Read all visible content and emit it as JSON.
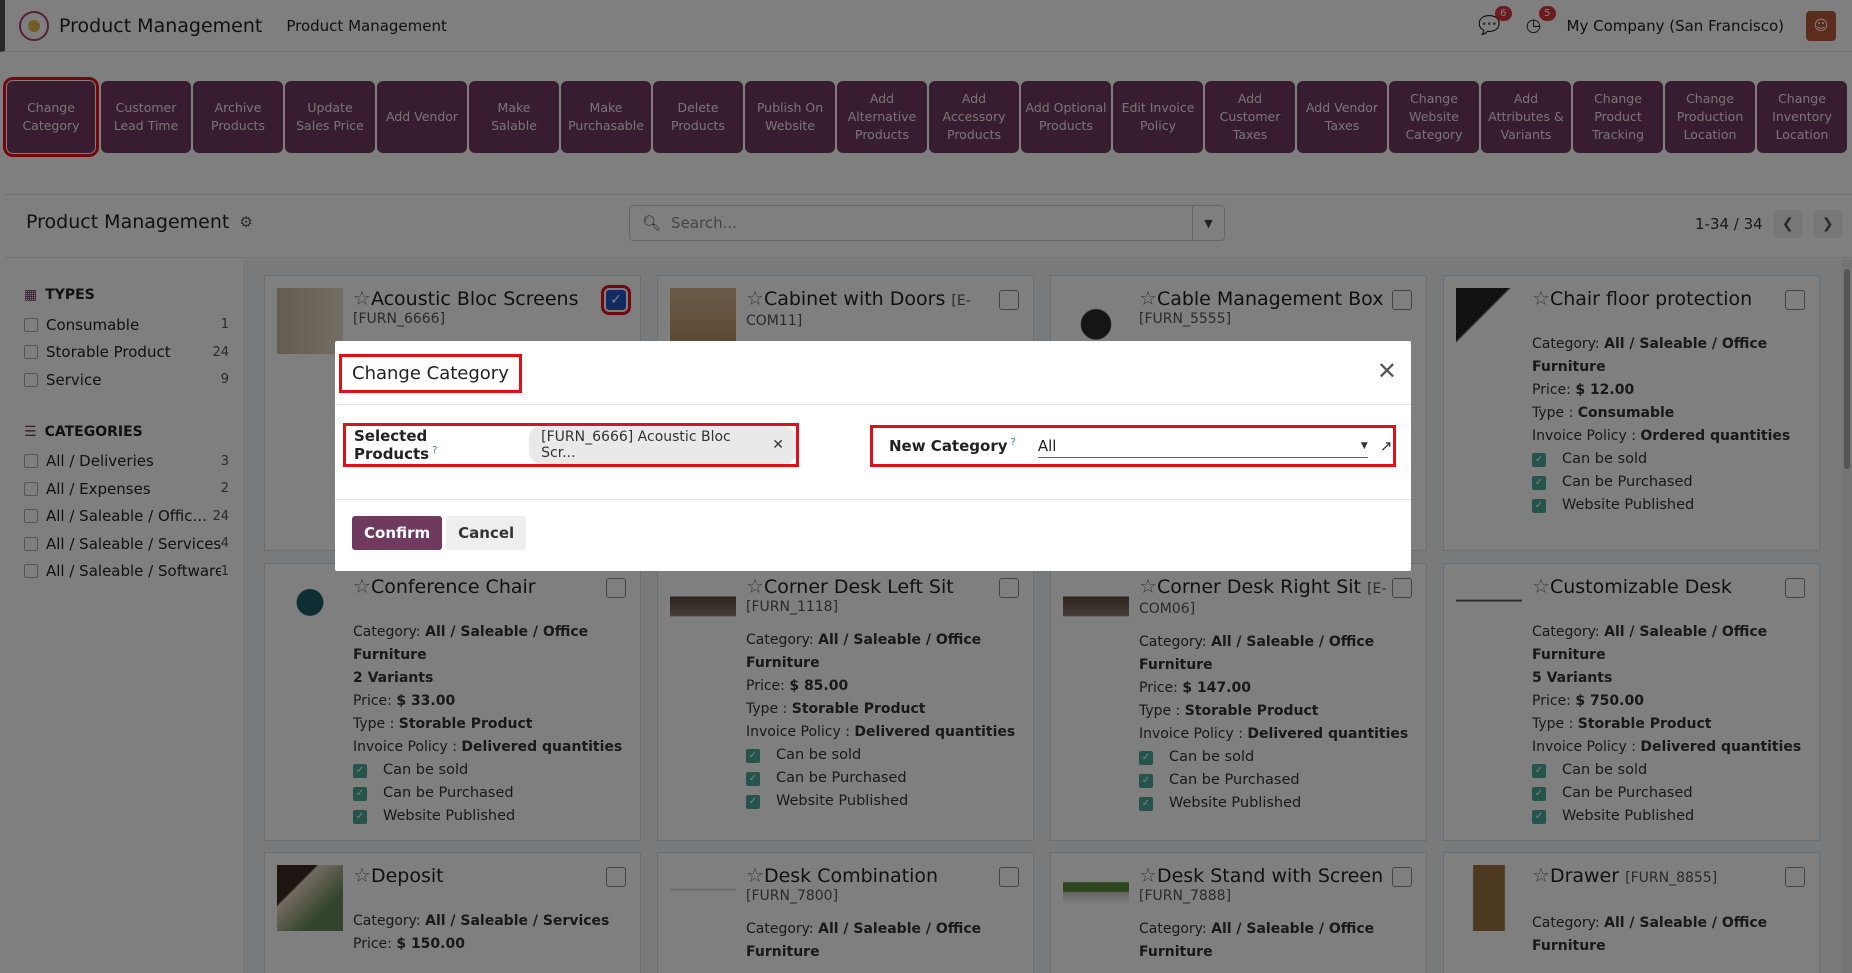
{
  "topbar": {
    "app_name": "Product Management",
    "menu": "Product Management",
    "company": "My Company (San Francisco)",
    "messages_count": "6",
    "activities_count": "5"
  },
  "actions": [
    "Change Category",
    "Customer Lead Time",
    "Archive Products",
    "Update Sales Price",
    "Add Vendor",
    "Make Salable",
    "Make Purchasable",
    "Delete Products",
    "Publish On Website",
    "Add Alternative Products",
    "Add Accessory Products",
    "Add Optional Products",
    "Edit Invoice Policy",
    "Add Customer Taxes",
    "Add Vendor Taxes",
    "Change Website Category",
    "Add Attributes & Variants",
    "Change Product Tracking",
    "Change Production Location",
    "Change Inventory Location"
  ],
  "control_panel": {
    "title": "Product Management",
    "search_placeholder": "Search...",
    "pager": "1-34 / 34"
  },
  "sidebar": {
    "types_title": "TYPES",
    "types": [
      {
        "label": "Consumable",
        "count": "1"
      },
      {
        "label": "Storable Product",
        "count": "24"
      },
      {
        "label": "Service",
        "count": "9"
      }
    ],
    "categories_title": "CATEGORIES",
    "categories": [
      {
        "label": "All / Deliveries",
        "count": "3"
      },
      {
        "label": "All / Expenses",
        "count": "2"
      },
      {
        "label": "All / Saleable / Offic...",
        "count": "24"
      },
      {
        "label": "All / Saleable / Services",
        "count": "4"
      },
      {
        "label": "All / Saleable / Software",
        "count": "1"
      }
    ]
  },
  "cards": {
    "c1": {
      "name": "Acoustic Bloc Screens",
      "ref": "[FURN_6666]"
    },
    "c2": {
      "name": "Cabinet with Doors",
      "ref_inline": "[E-",
      "ref": "COM11]"
    },
    "c3": {
      "name": "Cable Management Box",
      "ref": "[FURN_5555]"
    },
    "c4": {
      "name": "Chair floor protection",
      "cat_label": "Category:",
      "cat1": "All / Saleable / Office",
      "cat2": "Furniture",
      "price_label": "Price:",
      "price": "$ 12.00",
      "type_label": "Type :",
      "type": "Consumable",
      "inv_label": "Invoice Policy :",
      "inv": "Ordered quantities"
    },
    "c5": {
      "name": "Conference Chair",
      "cat_label": "Category:",
      "cat1": "All / Saleable / Office",
      "cat2": "Furniture",
      "variants": "2 Variants",
      "price_label": "Price:",
      "price": "$ 33.00",
      "type_label": "Type :",
      "type": "Storable Product",
      "inv_label": "Invoice Policy :",
      "inv": "Delivered quantities"
    },
    "c6": {
      "name": "Corner Desk Left Sit",
      "ref": "[FURN_1118]",
      "cat_label": "Category:",
      "cat1": "All / Saleable / Office",
      "cat2": "Furniture",
      "price_label": "Price:",
      "price": "$ 85.00",
      "type_label": "Type :",
      "type": "Storable Product",
      "inv_label": "Invoice Policy :",
      "inv": "Delivered quantities"
    },
    "c7": {
      "name": "Corner Desk Right Sit",
      "ref_inline": "[E-",
      "ref": "COM06]",
      "cat_label": "Category:",
      "cat1": "All / Saleable / Office",
      "cat2": "Furniture",
      "price_label": "Price:",
      "price": "$ 147.00",
      "type_label": "Type :",
      "type": "Storable Product",
      "inv_label": "Invoice Policy :",
      "inv": "Delivered quantities"
    },
    "c8": {
      "name": "Customizable Desk",
      "cat_label": "Category:",
      "cat1": "All / Saleable / Office",
      "cat2": "Furniture",
      "variants": "5 Variants",
      "price_label": "Price:",
      "price": "$ 750.00",
      "type_label": "Type :",
      "type": "Storable Product",
      "inv_label": "Invoice Policy :",
      "inv": "Delivered quantities"
    },
    "c9": {
      "name": "Deposit",
      "cat_label": "Category:",
      "cat1": "All / Saleable / Services",
      "price_label": "Price:",
      "price": "$ 150.00"
    },
    "c10": {
      "name": "Desk Combination",
      "ref": "[FURN_7800]",
      "cat_label": "Category:",
      "cat1": "All / Saleable / Office",
      "cat2": "Furniture"
    },
    "c11": {
      "name": "Desk Stand with Screen",
      "ref": "[FURN_7888]",
      "cat_label": "Category:",
      "cat1": "All / Saleable / Office",
      "cat2": "Furniture"
    },
    "c12": {
      "name": "Drawer",
      "ref_inline": "[FURN_8855]",
      "cat_label": "Category:",
      "cat1": "All / Saleable / Office",
      "cat2": "Furniture"
    }
  },
  "checks": {
    "sold": "Can be sold",
    "purchased": "Can be Purchased",
    "published": "Website Published"
  },
  "modal": {
    "title": "Change Category",
    "selected_label": "Selected Products",
    "help": "?",
    "tag": "[FURN_6666] Acoustic Bloc Scr...",
    "new_category_label": "New Category",
    "new_category_value": "All",
    "confirm": "Confirm",
    "cancel": "Cancel"
  }
}
